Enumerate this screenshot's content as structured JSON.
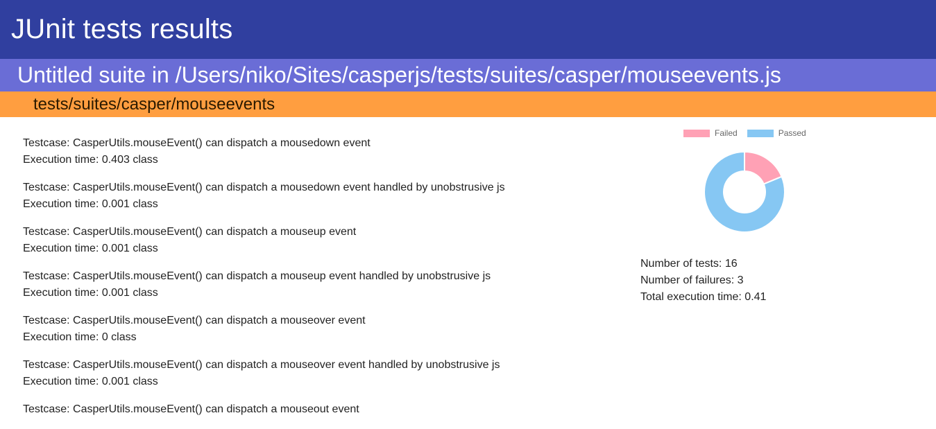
{
  "header": {
    "title": "JUnit tests results"
  },
  "suite": {
    "title": "Untitled suite in /Users/niko/Sites/casperjs/tests/suites/casper/mouseevents.js"
  },
  "suite_path": {
    "label": "tests/suites/casper/mouseevents"
  },
  "testcases": [
    {
      "name": "Testcase: CasperUtils.mouseEvent() can dispatch a mousedown event",
      "exec": "Execution time: 0.403 class"
    },
    {
      "name": "Testcase: CasperUtils.mouseEvent() can dispatch a mousedown event handled by unobstrusive js",
      "exec": "Execution time: 0.001 class"
    },
    {
      "name": "Testcase: CasperUtils.mouseEvent() can dispatch a mouseup event",
      "exec": "Execution time: 0.001 class"
    },
    {
      "name": "Testcase: CasperUtils.mouseEvent() can dispatch a mouseup event handled by unobstrusive js",
      "exec": "Execution time: 0.001 class"
    },
    {
      "name": "Testcase: CasperUtils.mouseEvent() can dispatch a mouseover event",
      "exec": "Execution time: 0 class"
    },
    {
      "name": "Testcase: CasperUtils.mouseEvent() can dispatch a mouseover event handled by unobstrusive js",
      "exec": "Execution time: 0.001 class"
    },
    {
      "name": "Testcase: CasperUtils.mouseEvent() can dispatch a mouseout event",
      "exec": ""
    }
  ],
  "chart_data": {
    "type": "pie",
    "categories": [
      "Failed",
      "Passed"
    ],
    "values": [
      3,
      13
    ],
    "colors": [
      "#ffa1b5",
      "#86c7f3"
    ],
    "legend": "top"
  },
  "stats": {
    "tests": "Number of tests: 16",
    "failures": "Number of failures: 3",
    "time": "Total execution time: 0.41"
  },
  "colors": {
    "header": "#303f9f",
    "suite": "#6a6dd6",
    "path": "#ff9e40"
  }
}
